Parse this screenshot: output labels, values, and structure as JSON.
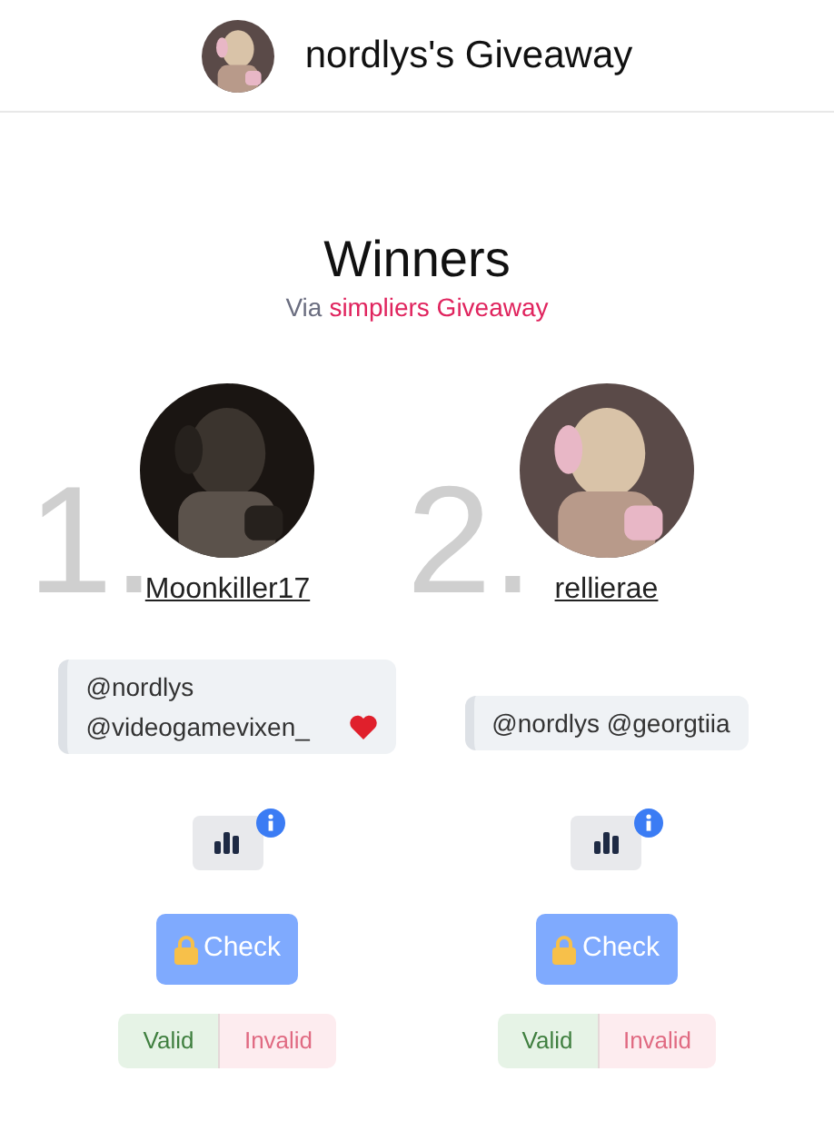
{
  "header": {
    "title": "nordlys's Giveaway"
  },
  "heading": {
    "title": "Winners",
    "via": "Via",
    "source": "simpliers Giveaway"
  },
  "winners": [
    {
      "rank": "1.",
      "username": "Moonkiller17",
      "comment": "@nordlys @videogamevixen_",
      "heart": true,
      "check": "Check",
      "valid": "Valid",
      "invalid": "Invalid"
    },
    {
      "rank": "2.",
      "username": "rellierae",
      "comment": "@nordlys @georgtiia",
      "heart": false,
      "check": "Check",
      "valid": "Valid",
      "invalid": "Invalid"
    }
  ]
}
